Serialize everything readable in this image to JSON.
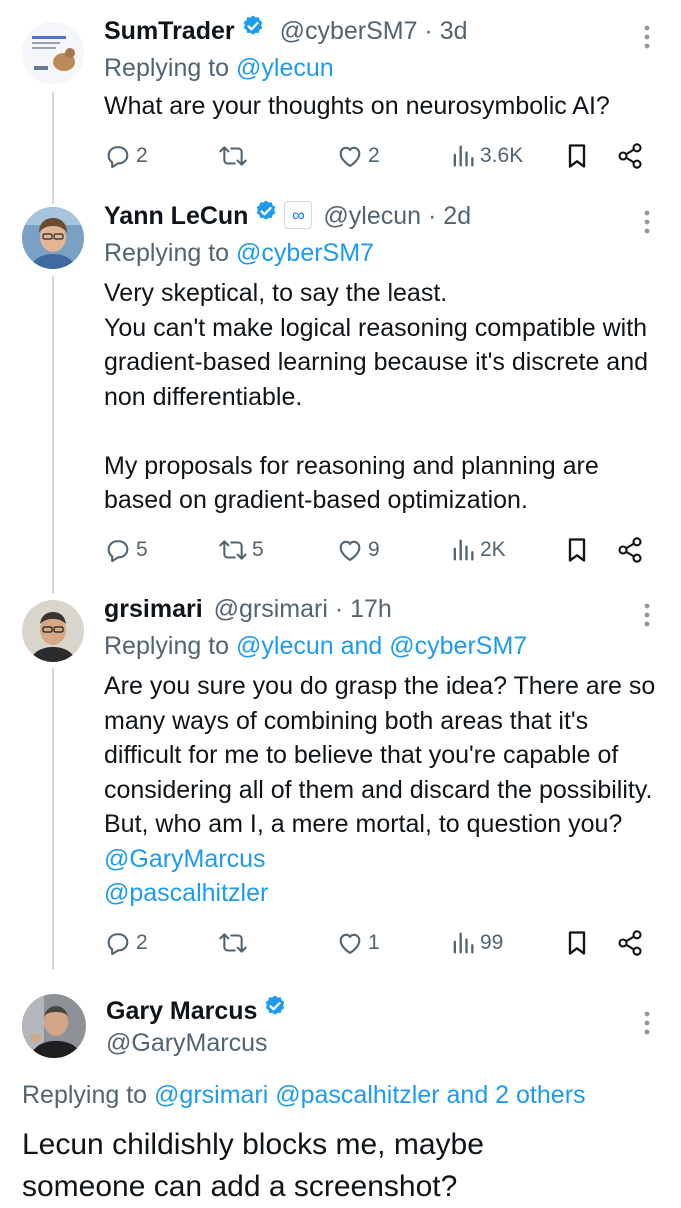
{
  "colors": {
    "accent": "#1d9bf0",
    "muted": "#536471",
    "text": "#0f1419",
    "thread": "#cfd9de"
  },
  "tweets": [
    {
      "name": "SumTrader",
      "verified": true,
      "handle": "@cyberSM7",
      "time": "3d",
      "replying_label": "Replying to ",
      "replying_to": "@ylecun",
      "text": "What are your thoughts on neurosymbolic AI?",
      "replies": "2",
      "retweets": "",
      "likes": "2",
      "views": "3.6K"
    },
    {
      "name": "Yann LeCun",
      "verified": true,
      "affiliate": "meta-icon",
      "affiliate_glyph": "∞",
      "handle": "@ylecun",
      "time": "2d",
      "replying_label": "Replying to ",
      "replying_to": "@cyberSM7",
      "text": "Very skeptical, to say the least.\nYou can't make logical reasoning compatible with gradient-based learning because it's discrete and non differentiable.\n\nMy proposals for reasoning and planning are based on gradient-based optimization.",
      "replies": "5",
      "retweets": "5",
      "likes": "9",
      "views": "2K"
    },
    {
      "name": "grsimari",
      "verified": false,
      "handle": "@grsimari",
      "time": "17h",
      "replying_label": "Replying to ",
      "replying_to": "@ylecun and @cyberSM7",
      "text_before_mentions": "Are you sure you do grasp the idea? There are so many ways of combining both areas that it's difficult for me to believe that you're capable of considering all of them and discard the possibility. But, who am I, a mere mortal, to question you? ",
      "mention_1": "@GaryMarcus",
      "mention_2": "@pascalhitzler",
      "replies": "2",
      "retweets": "",
      "likes": "1",
      "views": "99"
    },
    {
      "name": "Gary Marcus",
      "verified": true,
      "handle": "@GaryMarcus",
      "replying_label": "Replying to ",
      "replying_to": "@grsimari @pascalhitzler and 2 others",
      "text": "Lecun childishly blocks me, maybe someone can add a screenshot?"
    }
  ],
  "separators": {
    "dot": " · "
  }
}
